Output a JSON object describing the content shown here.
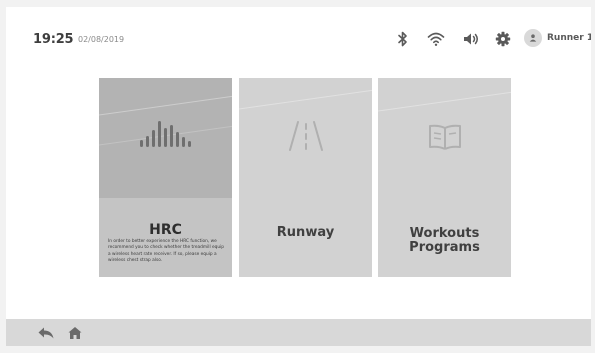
{
  "status_bar": {
    "time": "19:25",
    "date": "02/08/2019",
    "user_name": "Runner 1",
    "icons": [
      "bluetooth-icon",
      "wifi-icon",
      "volume-icon",
      "settings-gear-icon",
      "user-avatar-icon"
    ]
  },
  "tiles": [
    {
      "id": "hrc",
      "title": "HRC",
      "icon": "heart-rate-bars-icon",
      "description": "In order to better experience the HRC function, we recommend you to check whether the treadmill equip a wireless heart rate receiver. If so, please equip a wireless chest strap also.",
      "selected": true
    },
    {
      "id": "runway",
      "title": "Runway",
      "icon": "road-icon"
    },
    {
      "id": "workouts",
      "title": "Workouts\nPrograms",
      "icon": "open-book-icon"
    }
  ],
  "bottom_bar": {
    "icons": [
      "back-arrow-icon",
      "home-icon"
    ]
  },
  "colors": {
    "selected_tile": "#b3b3b3",
    "tile": "#d2d2d2",
    "bottom_bar": "#d8d8d8",
    "text_dark": "#3e3e3e"
  }
}
